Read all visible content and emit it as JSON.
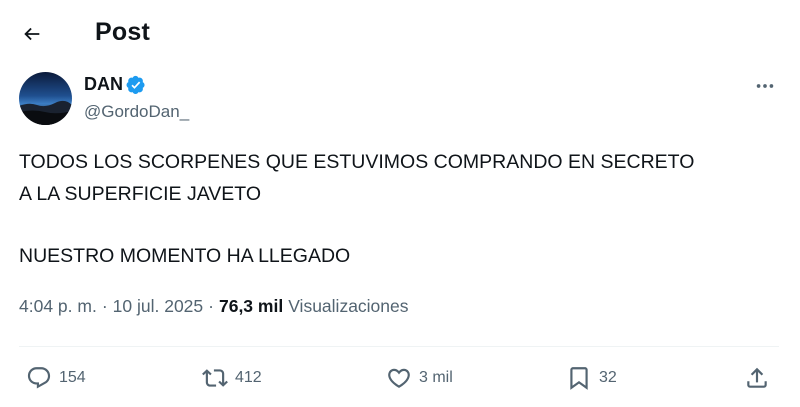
{
  "header": {
    "back_icon": "arrow-left-icon",
    "title": "Post"
  },
  "author": {
    "display_name": "DAN",
    "username": "@GordoDan_",
    "verified_color": "#1d9bf0"
  },
  "tweet": {
    "lines": [
      "TODOS LOS SCORPENES QUE ESTUVIMOS COMPRANDO EN SECRETO",
      "A LA SUPERFICIE JAVETO",
      "NUESTRO MOMENTO HA LLEGADO"
    ]
  },
  "meta": {
    "time": "4:04 p. m.",
    "separator": "·",
    "date": "10 jul. 2025",
    "views_count": "76,3 mil",
    "views_label": "Visualizaciones"
  },
  "actions": {
    "reply_count": "154",
    "repost_count": "412",
    "like_count": "3 mil",
    "bookmark_count": "32"
  },
  "colors": {
    "text": "#0f1419",
    "secondary": "#536471",
    "divider": "#eff3f4",
    "accent": "#1d9bf0"
  }
}
